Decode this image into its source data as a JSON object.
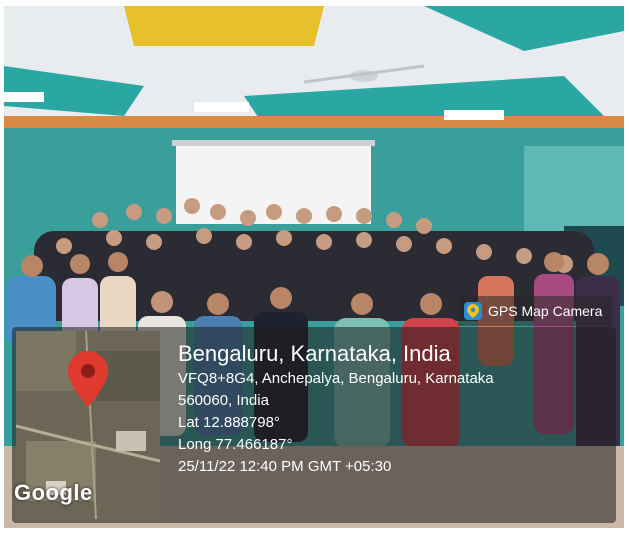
{
  "badge": {
    "label": "GPS Map Camera",
    "icon": "gps-map-camera-icon"
  },
  "location": {
    "city": "Bengaluru, Karnataka, India",
    "address_line1": "VFQ8+8G4, Anchepalya, Bengaluru, Karnataka",
    "address_line2": "560060, India",
    "lat": "Lat 12.888798°",
    "long": "Long 77.466187°",
    "datetime": "25/11/22 12:40 PM GMT +05:30"
  },
  "map": {
    "logo": "Google",
    "pin": "map-pin-icon"
  },
  "colors": {
    "wall": "#3a9e9a",
    "overlay": "#1e1e1e",
    "pin": "#e03a2e"
  }
}
